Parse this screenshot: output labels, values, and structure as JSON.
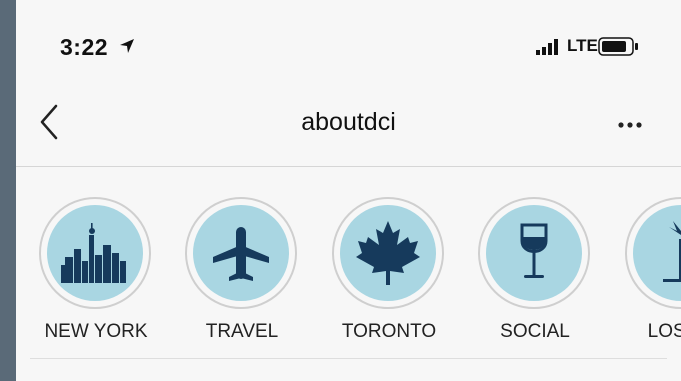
{
  "status": {
    "time": "3:22",
    "network": "LTE"
  },
  "header": {
    "title": "aboutdci"
  },
  "highlights": [
    {
      "label": "NEW YORK",
      "icon": "skyline-icon"
    },
    {
      "label": "TRAVEL",
      "icon": "airplane-icon"
    },
    {
      "label": "TORONTO",
      "icon": "maple-leaf-icon"
    },
    {
      "label": "SOCIAL",
      "icon": "wine-glass-icon"
    },
    {
      "label": "LOS AN",
      "icon": "palm-tree-icon"
    }
  ],
  "colors": {
    "highlight_fill": "#a9d6e2",
    "icon_color": "#163a5c",
    "background": "#f7f7f7"
  }
}
